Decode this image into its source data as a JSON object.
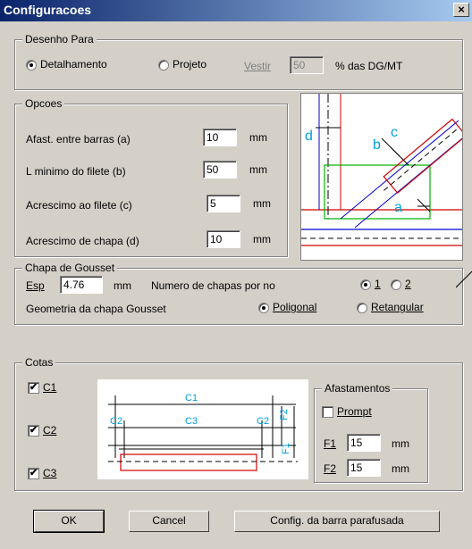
{
  "window": {
    "title": "Configuracoes",
    "close_glyph": "×"
  },
  "desenho": {
    "legend": "Desenho Para",
    "opt1": "Detalhamento",
    "opt2": "Projeto",
    "vestir_label": "Vestir",
    "vestir_value": "50",
    "pct_label": "% das DG/MT",
    "selected": "Detalhamento"
  },
  "opcoes": {
    "legend": "Opcoes",
    "rows": [
      {
        "label": "Afast. entre barras (a)",
        "value": "10",
        "unit": "mm"
      },
      {
        "label": "L minimo do filete (b)",
        "value": "50",
        "unit": "mm"
      },
      {
        "label": "Acrescimo ao filete (c)",
        "value": "5",
        "unit": "mm"
      },
      {
        "label": "Acrescimo de chapa (d)",
        "value": "10",
        "unit": "mm"
      }
    ]
  },
  "gousset": {
    "legend": "Chapa de Gousset",
    "esp_label": "Esp",
    "esp_value": "4.76",
    "esp_unit": "mm",
    "num_label": "Numero de chapas por no",
    "num_opt1": "1",
    "num_opt2": "2",
    "geom_label": "Geometria da chapa Gousset",
    "geom_opt1": "Poligonal",
    "geom_opt2": "Retangular"
  },
  "cotas": {
    "legend": "Cotas",
    "checks": [
      {
        "label": "C1",
        "checked": true
      },
      {
        "label": "C2",
        "checked": true
      },
      {
        "label": "C3",
        "checked": true
      }
    ],
    "diagram": {
      "c1": "C1",
      "c2a": "C2",
      "c3": "C3",
      "c2b": "C2",
      "f2": "F2",
      "f1": "F1"
    }
  },
  "afast": {
    "legend": "Afastamentos",
    "prompt_label": "Prompt",
    "f1_label": "F1",
    "f1_value": "15",
    "f2_label": "F2",
    "f2_value": "15",
    "unit": "mm"
  },
  "figure_labels": {
    "a": "a",
    "b": "b",
    "c": "c",
    "d": "d"
  },
  "buttons": {
    "ok": "OK",
    "cancel": "Cancel",
    "config": "Config. da barra parafusada"
  },
  "check_glyph": "✔"
}
